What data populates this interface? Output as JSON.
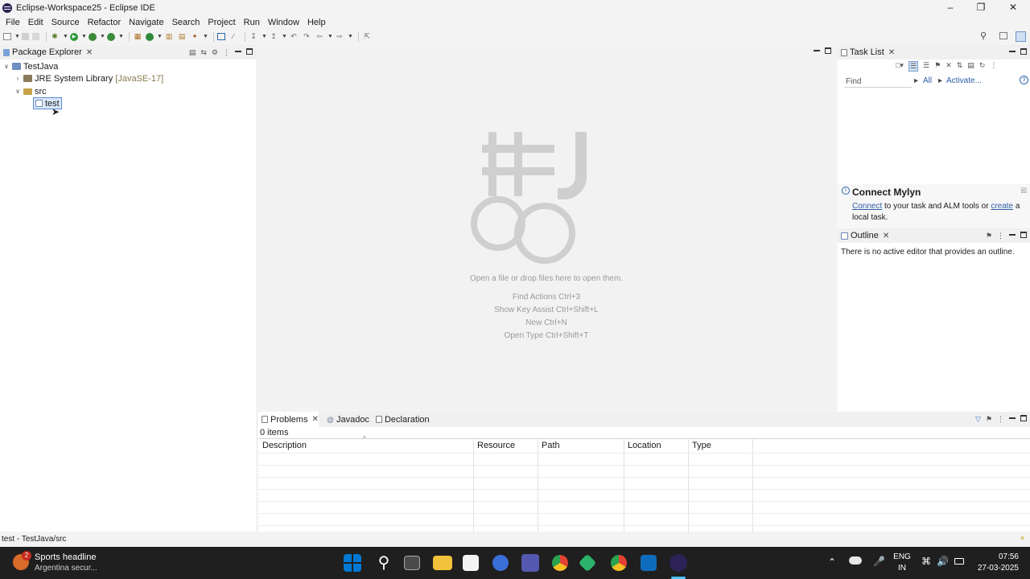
{
  "window": {
    "title": "Eclipse-Workspace25 - Eclipse IDE"
  },
  "menu": [
    "File",
    "Edit",
    "Source",
    "Refactor",
    "Navigate",
    "Search",
    "Project",
    "Run",
    "Window",
    "Help"
  ],
  "package_explorer": {
    "tab_label": "Package Explorer",
    "project": "TestJava",
    "library": "JRE System Library",
    "library_version": "[JavaSE-17]",
    "src": "src",
    "package": "test"
  },
  "editor": {
    "hint_open": "Open a file or drop files here to open them.",
    "find_actions": "Find Actions Ctrl+3",
    "key_assist": "Show Key Assist Ctrl+Shift+L",
    "new": "New Ctrl+N",
    "open_type": "Open Type Ctrl+Shift+T"
  },
  "task_list": {
    "tab_label": "Task List",
    "find_placeholder": "Find",
    "all": "All",
    "activate": "Activate..."
  },
  "mylyn": {
    "title": "Connect Mylyn",
    "connect": "Connect",
    "text1": "to your task and ALM tools or",
    "create": "create",
    "text2": "a",
    "text3": "local task."
  },
  "outline": {
    "tab_label": "Outline",
    "message": "There is no active editor that provides an outline."
  },
  "problems": {
    "tabs": [
      "Problems",
      "Javadoc",
      "Declaration"
    ],
    "count": "0 items",
    "columns": [
      "Description",
      "Resource",
      "Path",
      "Location",
      "Type"
    ]
  },
  "status": {
    "text": "test - TestJava/src"
  },
  "taskbar": {
    "news_title": "Sports headline",
    "news_sub": "Argentina secur...",
    "news_badge": "2",
    "lang1": "ENG",
    "lang2": "IN",
    "time": "07:56",
    "date": "27-03-2025"
  },
  "colors": {
    "accent": "#0078d4",
    "link": "#2a5ea6",
    "taskbar": "#1f1f1f"
  }
}
